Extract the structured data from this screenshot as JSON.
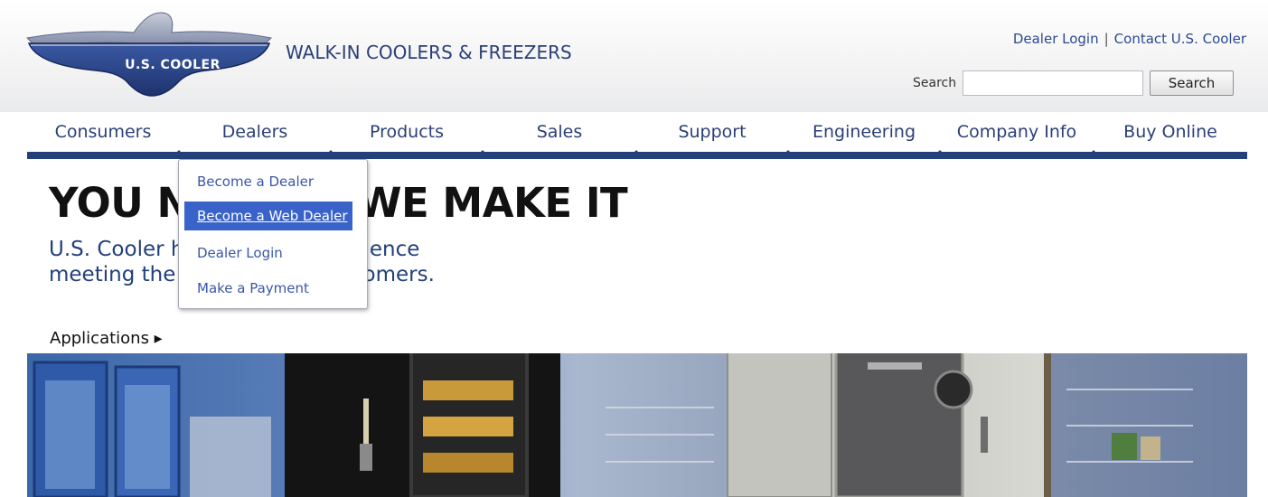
{
  "header": {
    "logo_text": "U.S. COOLER",
    "tagline": "WALK-IN COOLERS & FREEZERS",
    "top_links": [
      "Dealer Login",
      "Contact U.S. Cooler"
    ],
    "search_label": "Search",
    "search_value": "",
    "search_button": "Search"
  },
  "nav": {
    "items": [
      "Consumers",
      "Dealers",
      "Products",
      "Sales",
      "Support",
      "Engineering",
      "Company Info",
      "Buy Online"
    ]
  },
  "dropdown": {
    "items": [
      "Become a Dealer",
      "Become a Web Dealer",
      "Dealer Login",
      "Make a Payment"
    ],
    "active_index": 1
  },
  "hero": {
    "headline": "YOU NEED IT, WE MAKE IT",
    "subhead_line1": "U.S. Cooler has years of experience",
    "subhead_line2": "meeting the needs of our customers.",
    "applications_label": "Applications ▸"
  },
  "colors": {
    "brand_navy": "#23407a",
    "link_blue": "#2b4a8f",
    "dropdown_active": "#3a63ca"
  }
}
